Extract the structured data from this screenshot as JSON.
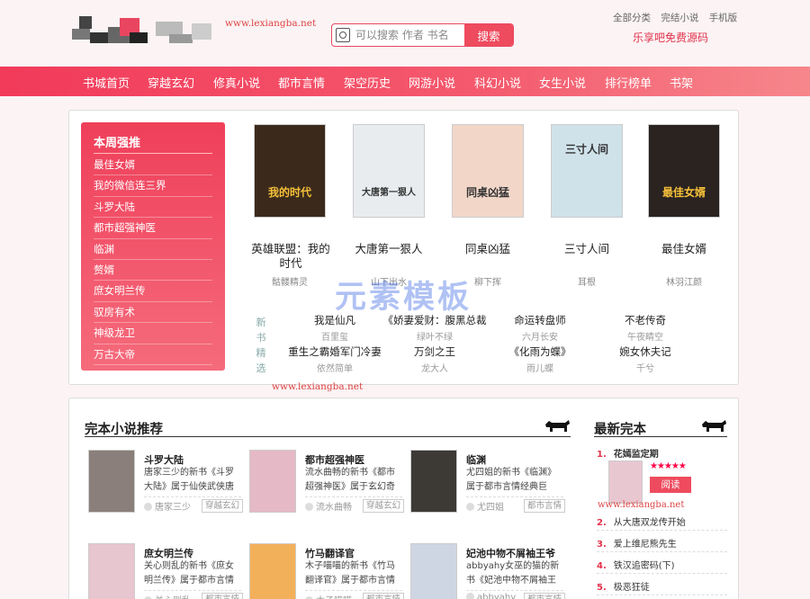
{
  "header": {
    "site_url": "www.lexiangba.net",
    "search_placeholder": "可以搜索 作者 书名",
    "search_button": "搜索",
    "top_links": [
      "全部分类",
      "完结小说",
      "手机版"
    ],
    "slogan": "乐享吧免费源码"
  },
  "nav": [
    "书城首页",
    "穿越玄幻",
    "修真小说",
    "都市言情",
    "架空历史",
    "网游小说",
    "科幻小说",
    "女生小说",
    "排行榜单",
    "书架"
  ],
  "weekly": {
    "title": "本周强推",
    "items": [
      "最佳女婿",
      "我的微信连三界",
      "斗罗大陆",
      "都市超强神医",
      "临渊",
      "赘婿",
      "庶女明兰传",
      "驭房有术",
      "神级龙卫",
      "万古大帝"
    ]
  },
  "featured": [
    {
      "title": "英雄联盟：我的时代",
      "author": "骷髅精灵",
      "cover_text": "我的时代",
      "cover_color": "#3b2a1c"
    },
    {
      "title": "大唐第一狠人",
      "author": "山下出水",
      "cover_text": "大唐第一狠人",
      "cover_color": "#e9ecef"
    },
    {
      "title": "同桌凶猛",
      "author": "柳下挥",
      "cover_text": "同桌凶猛",
      "cover_color": "#f2d7c9"
    },
    {
      "title": "三寸人间",
      "author": "耳根",
      "cover_text": "三寸人间",
      "cover_color": "#cfe2ea"
    },
    {
      "title": "最佳女婿",
      "author": "林羽江颜",
      "cover_text": "最佳女婿",
      "cover_color": "#2a2320"
    }
  ],
  "new_tag": [
    "新",
    "书",
    "精",
    "选"
  ],
  "new_books": [
    {
      "title": "我是仙凡",
      "author": "百里玺"
    },
    {
      "title": "《娇妻爱财：腹黑总裁",
      "author": "绿叶不绿"
    },
    {
      "title": "命运转盘师",
      "author": "六月长安"
    },
    {
      "title": "不老传奇",
      "author": "午夜睛空"
    },
    {
      "title": "重生之霸婚军门冷妻",
      "author": "依然简单"
    },
    {
      "title": "万剑之王",
      "author": "龙大人"
    },
    {
      "title": "《化雨为蝶》",
      "author": "雨儿蝶"
    },
    {
      "title": "婉女休夫记",
      "author": "千兮"
    }
  ],
  "watermark": "元素模板",
  "finished": {
    "title": "完本小说推荐",
    "items": [
      {
        "title": "斗罗大陆",
        "desc": "唐家三少的新书《斗罗大陆》属于仙侠武侠唐门外门",
        "author": "唐家三少",
        "category": "穿越玄幻",
        "cover_color": "#8a7f7a"
      },
      {
        "title": "都市超强神医",
        "desc": "流水曲畅的新书《都市超强神医》属于玄幻奇幻身怀绝",
        "author": "流水曲畅",
        "category": "穿越玄幻",
        "cover_color": "#e6b9c6"
      },
      {
        "title": "临渊",
        "desc": "尤四姐的新书《临渊》属于都市言情经典巨献，网络原",
        "author": "尤四姐",
        "category": "都市言情",
        "cover_color": "#3d3a36"
      },
      {
        "title": "庶女明兰传",
        "desc": "关心则乱的新书《庶女明兰传》属于都市言情庶女明兰",
        "author": "关心则乱",
        "category": "都市言情",
        "cover_color": "#e8c6cf"
      },
      {
        "title": "竹马翻译官",
        "desc": "木子喵喵的新书《竹马翻译官》属于都市言情竹马翻译",
        "author": "木子喵喵",
        "category": "都市言情",
        "cover_color": "#f3b05a"
      },
      {
        "title": "妃池中物不屑袖王爷",
        "desc": "abbyahy女巫的猫的新书《妃池中物不屑袖王爷",
        "author": "abbyahy",
        "category": "都市言情",
        "cover_color": "#cfd6e3"
      }
    ]
  },
  "latest": {
    "title": "最新完本",
    "top": {
      "title": "花嫣监定期",
      "stars": "★★★★★",
      "read": "阅读"
    },
    "items": [
      "从大唐双龙传开始",
      "爱上维尼熊先生",
      "铁汉追密码(下)",
      "极恶狂徒"
    ],
    "url": "www.lexiangba.net"
  },
  "colors": {
    "accent": "#ee4b5e",
    "nav_start": "#f23a5a",
    "nav_end": "#f6878c"
  }
}
